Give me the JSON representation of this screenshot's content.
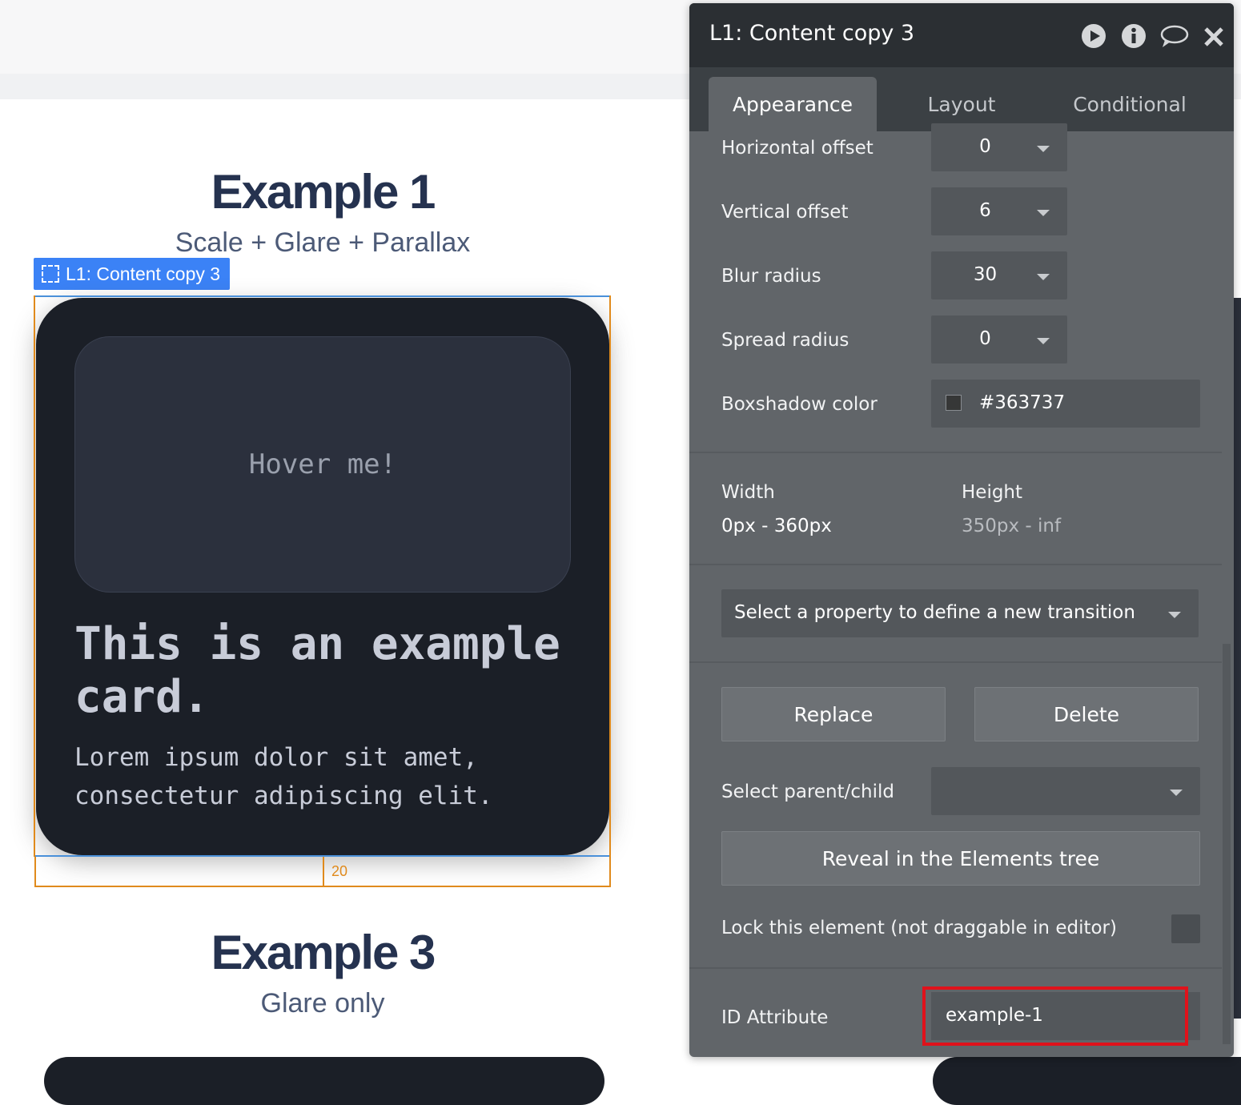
{
  "canvas": {
    "example1": {
      "title": "Example 1",
      "subtitle": "Scale + Glare + Parallax"
    },
    "example3": {
      "title": "Example 3",
      "subtitle": "Glare only"
    },
    "selection_label": "L1: Content copy 3",
    "margin_value": "20",
    "card": {
      "hover_text": "Hover me!",
      "title": "This is an example card.",
      "body": "Lorem ipsum dolor sit amet, consectetur adipiscing elit."
    }
  },
  "panel": {
    "title": "L1: Content copy 3",
    "icons": [
      "play-icon",
      "info-icon",
      "comment-icon",
      "close-icon"
    ],
    "tabs": {
      "appearance": "Appearance",
      "layout": "Layout",
      "conditional": "Conditional"
    },
    "shadow": {
      "horizontal_offset": {
        "label": "Horizontal offset",
        "value": "0"
      },
      "vertical_offset": {
        "label": "Vertical offset",
        "value": "6"
      },
      "blur_radius": {
        "label": "Blur radius",
        "value": "30"
      },
      "spread_radius": {
        "label": "Spread radius",
        "value": "0"
      },
      "color": {
        "label": "Boxshadow color",
        "value": "#363737"
      }
    },
    "dimensions": {
      "width_label": "Width",
      "width_value": "0px - 360px",
      "height_label": "Height",
      "height_value": "350px - inf"
    },
    "transition_placeholder": "Select a property to define a new transition",
    "buttons": {
      "replace": "Replace",
      "delete": "Delete",
      "reveal": "Reveal in the Elements tree"
    },
    "select_parent_label": "Select parent/child",
    "lock_label": "Lock this element (not draggable in editor)",
    "id_attribute": {
      "label": "ID Attribute",
      "value": "example-1"
    }
  },
  "colors": {
    "accent_blue": "#3b82f6",
    "margin_orange": "#e08a1c",
    "highlight_red": "#e0121b",
    "panel_bg": "#616569",
    "card_bg": "#1b1f27"
  }
}
